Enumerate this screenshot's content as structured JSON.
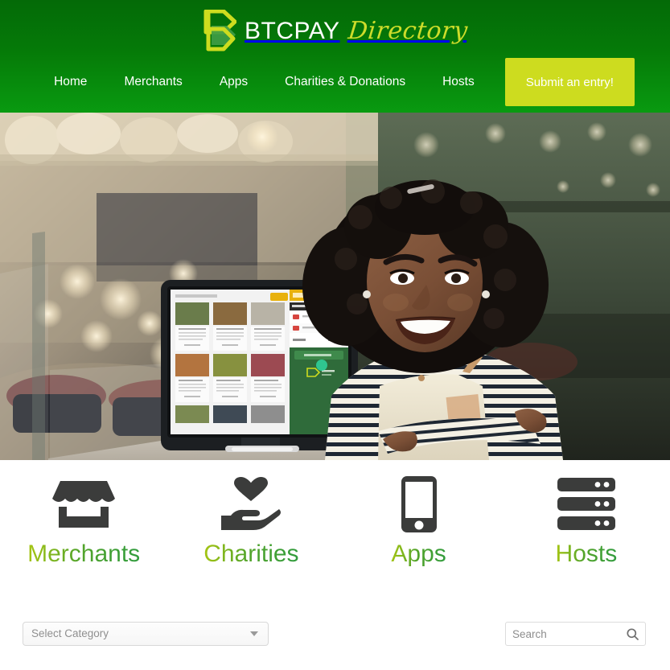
{
  "site": {
    "brand_primary": "BTCPAY",
    "brand_secondary": "Directory",
    "logo_icon": "btcpay-chevron-b-logo"
  },
  "colors": {
    "header_green_top": "#046a07",
    "header_green_bottom": "#099a10",
    "accent_lime": "#cddc1f",
    "label_gradient_start": "#a8c613",
    "label_gradient_end": "#2f9b3e",
    "icon_dark": "#3b3c3b"
  },
  "nav": {
    "items": [
      {
        "label": "Home",
        "name": "nav-item-home"
      },
      {
        "label": "Merchants",
        "name": "nav-item-merchants"
      },
      {
        "label": "Apps",
        "name": "nav-item-apps"
      },
      {
        "label": "Charities & Donations",
        "name": "nav-item-charities-donations"
      },
      {
        "label": "Hosts",
        "name": "nav-item-hosts"
      }
    ],
    "cta_label": "Submit an entry!"
  },
  "hero": {
    "description": "Photograph of a smiling small-business owner in a striped shirt and apron standing with arms crossed in a cafe, beside a desktop monitor displaying a BTCPay Server point-of-sale checkout screen with food product tiles and a green cart panel.",
    "alt": "Cafe owner with BTCPay Server point of sale monitor"
  },
  "categories": [
    {
      "label": "Merchants",
      "icon": "store-icon",
      "name": "category-merchants"
    },
    {
      "label": "Charities",
      "icon": "hand-holding-heart-icon",
      "name": "category-charities"
    },
    {
      "label": "Apps",
      "icon": "mobile-phone-icon",
      "name": "category-apps"
    },
    {
      "label": "Hosts",
      "icon": "server-rack-icon",
      "name": "category-hosts"
    }
  ],
  "filters": {
    "category_select": {
      "selected_label": "Select Category",
      "icon": "chevron-down-icon"
    },
    "search": {
      "value": "",
      "placeholder": "Search",
      "icon": "search-icon"
    }
  }
}
